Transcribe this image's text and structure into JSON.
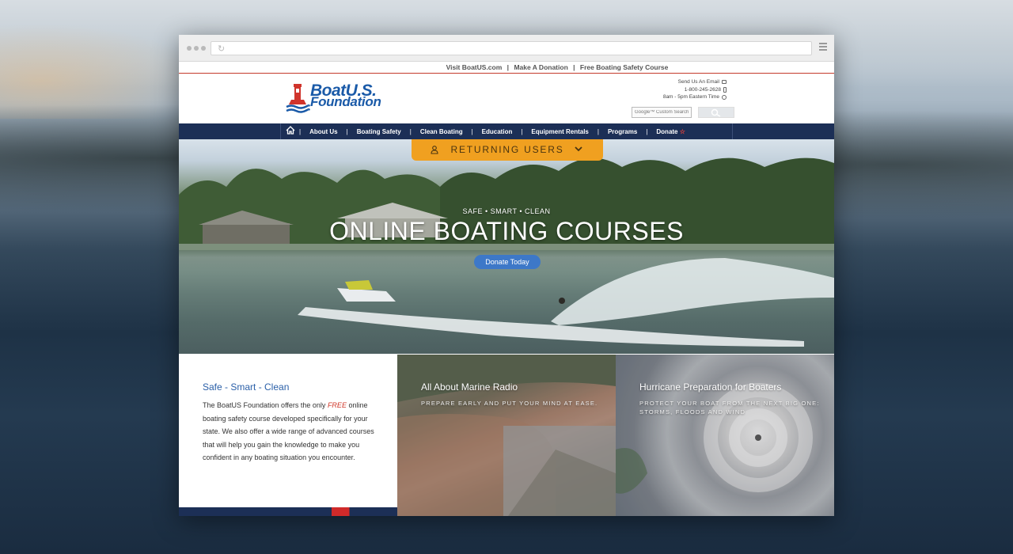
{
  "topbar": {
    "links": [
      "Visit BoatUS.com",
      "Make A Donation",
      "Free Boating Safety Course"
    ],
    "separator": "|"
  },
  "header": {
    "logo_line1": "BoatU.S.",
    "logo_line2": "Foundation",
    "contact": {
      "email_label": "Send Us An Email",
      "phone": "1-800-245-2628",
      "hours": "8am - 5pm Eastern Time"
    },
    "search": {
      "placeholder": "Google™ Custom Search"
    }
  },
  "nav": {
    "items": [
      "About Us",
      "Boating Safety",
      "Clean Boating",
      "Education",
      "Equipment Rentals",
      "Programs",
      "Donate"
    ],
    "separator": "|"
  },
  "hero": {
    "returning_label": "RETURNING USERS",
    "tagline": "SAFE • SMART • CLEAN",
    "title": "ONLINE BOATING COURSES",
    "donate_label": "Donate Today"
  },
  "cards": {
    "intro": {
      "title": "Safe - Smart - Clean",
      "text_before": "The BoatUS Foundation offers the only ",
      "text_highlight": "FREE",
      "text_after": " online boating safety course developed specifically for your state. We also offer a wide range of advanced courses that will help you gain the knowledge to make you confident in any boating situation you encounter."
    },
    "radio": {
      "title": "All About Marine Radio",
      "subtitle": "PREPARE EARLY AND PUT YOUR MIND AT EASE."
    },
    "hurricane": {
      "title": "Hurricane Preparation for Boaters",
      "subtitle": "PROTECT YOUR BOAT FROM THE NEXT BIG ONE: STORMS, FLOODS AND WIND"
    }
  },
  "colors": {
    "nav_bg": "#1c2f56",
    "accent_orange": "#f0a020",
    "brand_blue": "#1a5aa8",
    "link_blue": "#2a5fa8",
    "red": "#c43a2c"
  },
  "icons": [
    "home-icon",
    "email-icon",
    "phone-icon",
    "clock-icon",
    "search-icon",
    "user-icon",
    "chevron-down-icon",
    "star-icon",
    "buoy-logo-icon",
    "menu-icon"
  ]
}
